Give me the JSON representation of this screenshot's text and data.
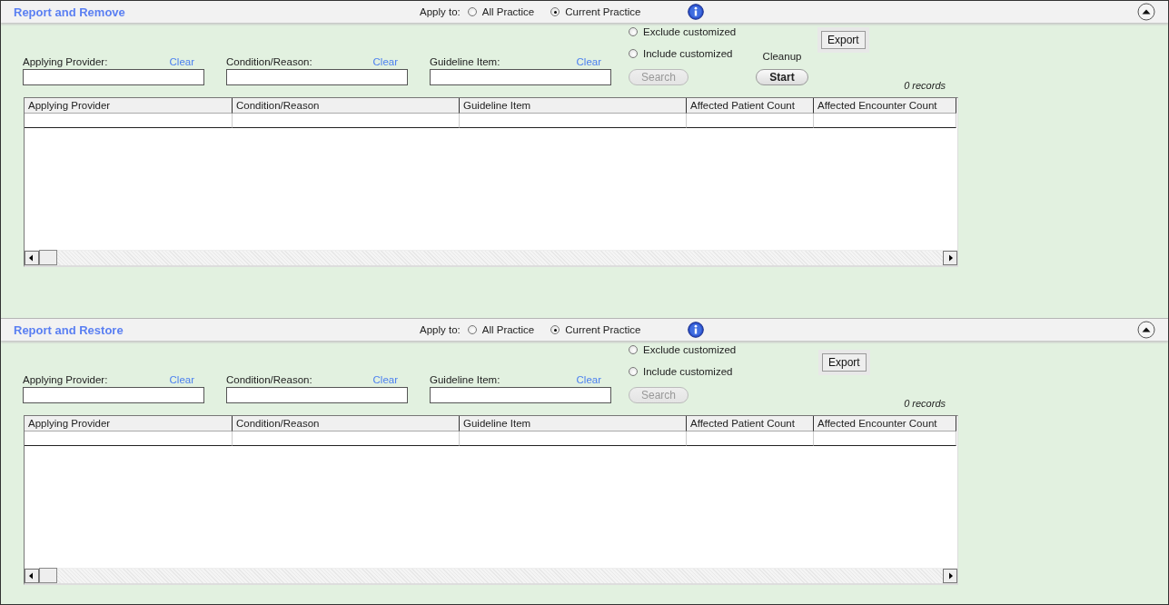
{
  "panels": [
    {
      "title": "Report and Remove",
      "apply_to": {
        "label": "Apply to:",
        "options": [
          {
            "label": "All Practice",
            "selected": false
          },
          {
            "label": "Current Practice",
            "selected": true
          }
        ]
      },
      "filters": [
        {
          "label": "Applying Provider:",
          "clear": "Clear"
        },
        {
          "label": "Condition/Reason:",
          "clear": "Clear"
        },
        {
          "label": "Guideline Item:",
          "clear": "Clear"
        }
      ],
      "customization": [
        {
          "label": "Exclude customized",
          "selected": false
        },
        {
          "label": "Include customized",
          "selected": false
        }
      ],
      "search": {
        "label": "Search",
        "disabled": true
      },
      "cleanup": {
        "label": "Cleanup",
        "button": "Start"
      },
      "export": "Export",
      "records": "0 records",
      "columns": [
        "Applying Provider",
        "Condition/Reason",
        "Guideline Item",
        "Affected Patient Count",
        "Affected Encounter Count"
      ]
    },
    {
      "title": "Report and Restore",
      "apply_to": {
        "label": "Apply to:",
        "options": [
          {
            "label": "All Practice",
            "selected": false
          },
          {
            "label": "Current Practice",
            "selected": true
          }
        ]
      },
      "filters": [
        {
          "label": "Applying Provider:",
          "clear": "Clear"
        },
        {
          "label": "Condition/Reason:",
          "clear": "Clear"
        },
        {
          "label": "Guideline Item:",
          "clear": "Clear"
        }
      ],
      "customization": [
        {
          "label": "Exclude customized",
          "selected": false
        },
        {
          "label": "Include customized",
          "selected": false
        }
      ],
      "search": {
        "label": "Search",
        "disabled": true
      },
      "export": "Export",
      "records": "0 records",
      "columns": [
        "Applying Provider",
        "Condition/Reason",
        "Guideline Item",
        "Affected Patient Count",
        "Affected Encounter Count"
      ]
    }
  ]
}
